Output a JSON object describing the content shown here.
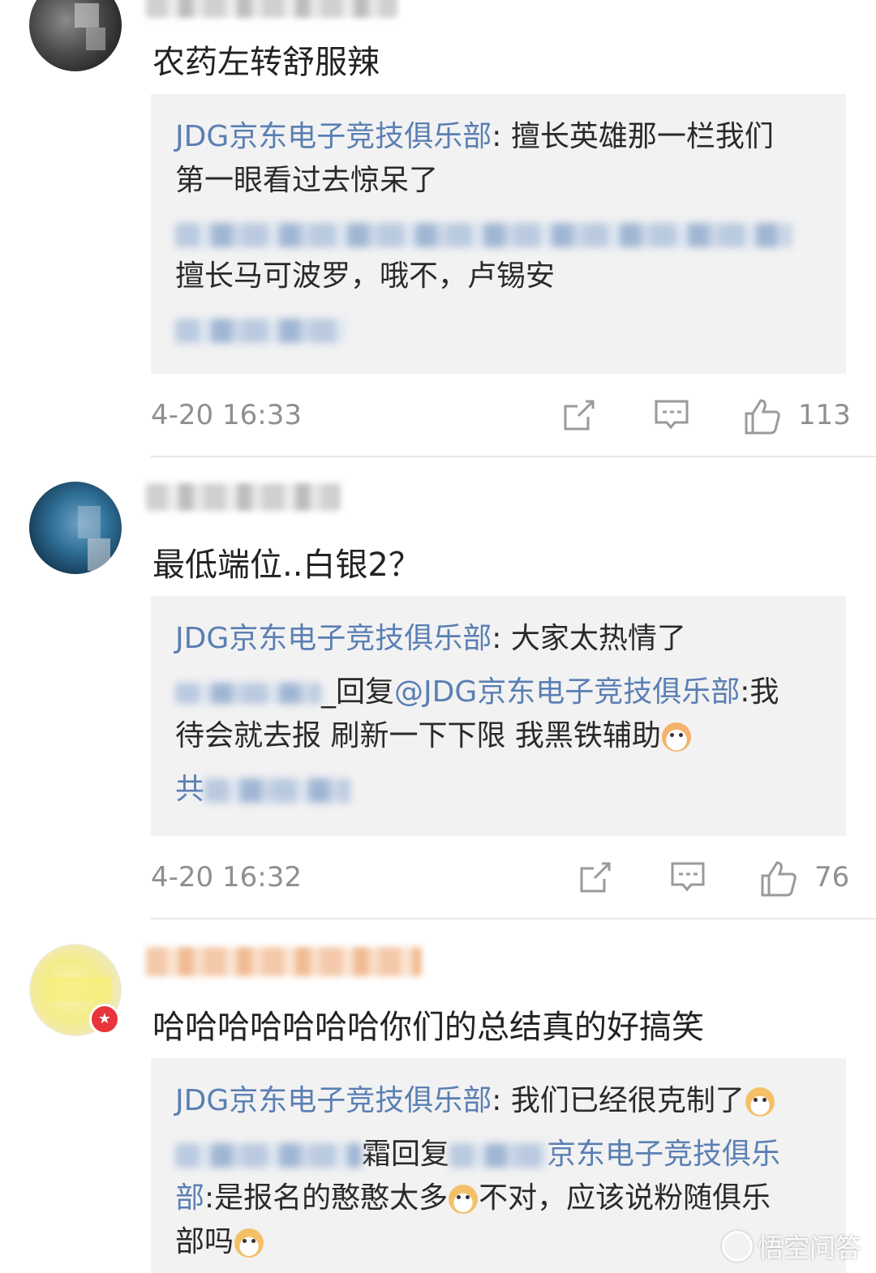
{
  "comments": [
    {
      "text": "农药左转舒服辣",
      "replies": {
        "line1_author": "JDG京东电子竞技俱乐部",
        "line1_sep": ": ",
        "line1_text": "擅长英雄那一栏我们",
        "line2_text": "第一眼看过去惊呆了",
        "line4_text": "擅长马可波罗，哦不，卢锡安"
      },
      "time": "4-20 16:33",
      "likes": "113"
    },
    {
      "text": "最低端位..白银2？",
      "replies": {
        "line1_author": "JDG京东电子竞技俱乐部",
        "line1_sep": ": ",
        "line1_text": "大家太热情了",
        "line2_mid": "_回复",
        "line2_link": "@JDG京东电子竞技俱乐部",
        "line2_text": ":我",
        "line3_text": "待会就去报 刷新一下下限 我黑铁辅助",
        "line4_prefix": "共"
      },
      "time": "4-20 16:32",
      "likes": "76"
    },
    {
      "text": "哈哈哈哈哈哈哈你们的总结真的好搞笑",
      "replies": {
        "line1_author": "JDG京东电子竞技俱乐部",
        "line1_sep": ": ",
        "line1_text": "我们已经很克制了",
        "line2_suffix": "霜回复",
        "line2_link_end": "京东电子竞技俱乐",
        "line3_link": "部",
        "line3_text_a": ":是报名的憨憨太多",
        "line3_text_b": "不对，应该说粉随俱乐",
        "line4_text": "部吗"
      }
    }
  ],
  "icons": {
    "repost": "repost-icon",
    "comment": "comment-icon",
    "like": "thumbs-up-icon",
    "badge": "star-badge-icon",
    "emoji_cat": "cat-emoji-icon",
    "emoji_doge": "doge-emoji-icon"
  },
  "watermark": {
    "text": "悟空问答"
  },
  "colors": {
    "link": "#5a7fb3",
    "reply_bg": "#f2f2f2",
    "meta": "#8f8f8f",
    "badge": "#e8343a"
  }
}
